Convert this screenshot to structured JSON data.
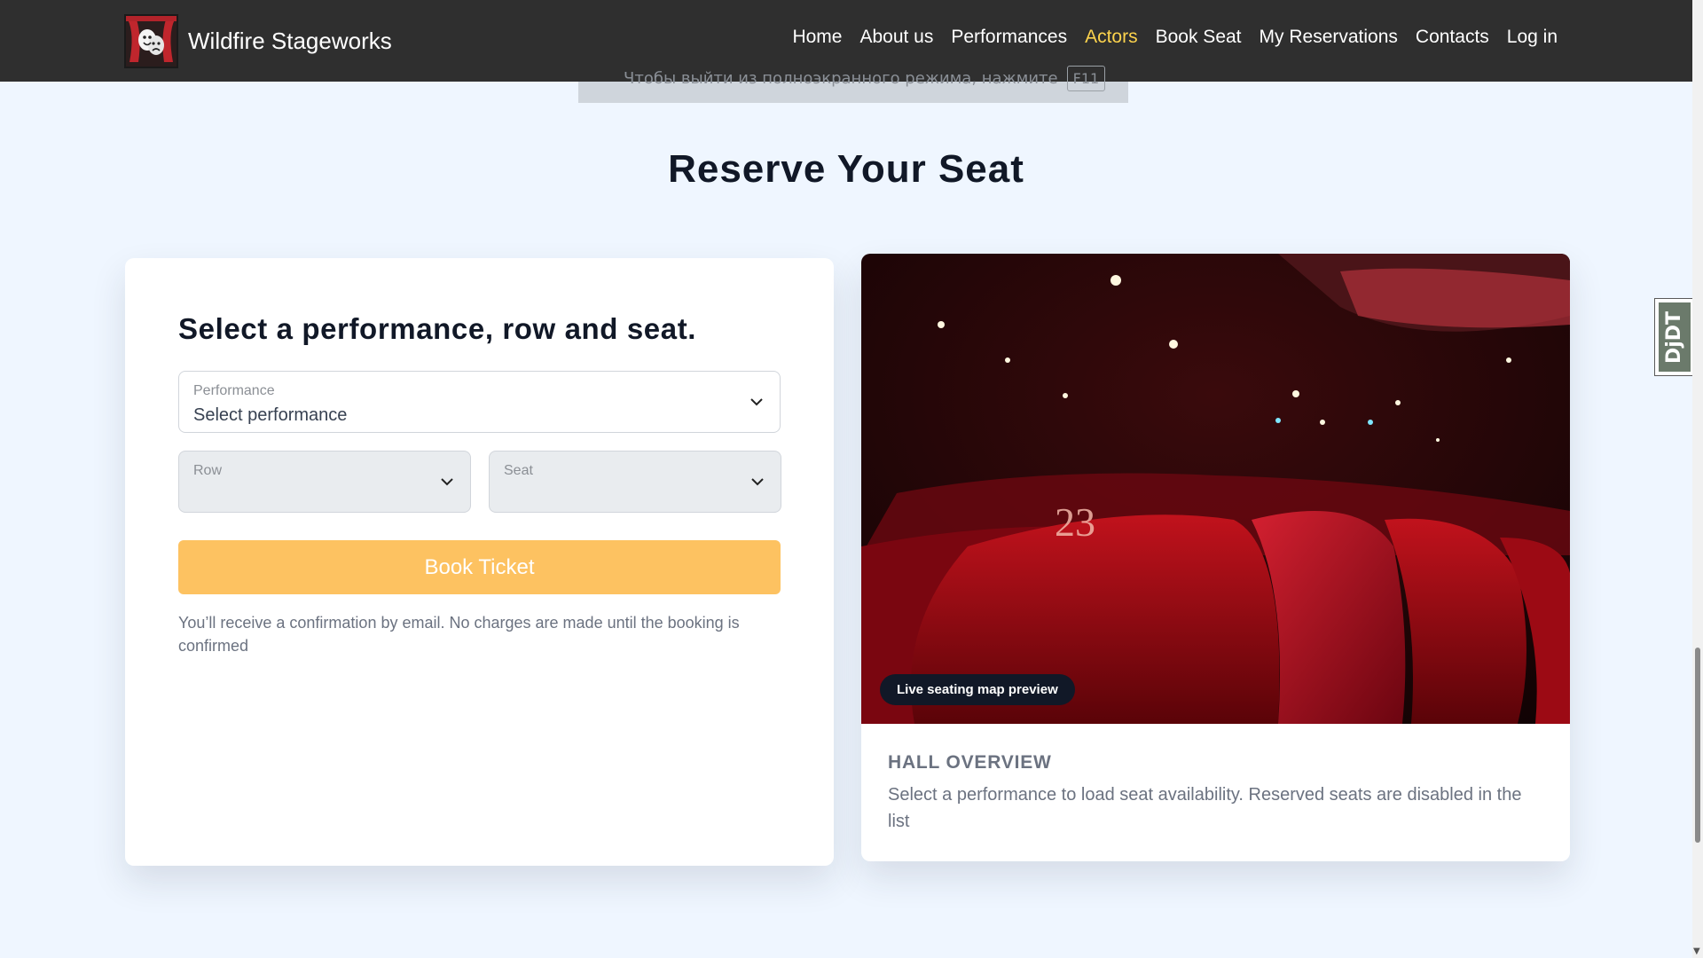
{
  "header": {
    "brand": "Wildfire Stageworks",
    "logo_icon": "theatre-masks-icon",
    "nav": [
      {
        "label": "Home",
        "active": false
      },
      {
        "label": "About us",
        "active": false
      },
      {
        "label": "Performances",
        "active": false
      },
      {
        "label": "Actors",
        "active": true
      },
      {
        "label": "Book Seat",
        "active": false
      },
      {
        "label": "My Reservations",
        "active": false
      },
      {
        "label": "Contacts",
        "active": false
      },
      {
        "label": "Log in",
        "active": false
      }
    ],
    "active_color": "#fcd34d"
  },
  "fullscreen_hint": {
    "text": "Чтобы выйти из полноэкранного режима, нажмите",
    "key": "F11"
  },
  "page_title": "Reserve Your Seat",
  "form": {
    "heading": "Select a performance, row and seat.",
    "performance": {
      "label": "Performance",
      "value": "Select performance"
    },
    "row": {
      "label": "Row",
      "value": ""
    },
    "seat": {
      "label": "Seat",
      "value": ""
    },
    "book_button": "Book Ticket",
    "note": "You’ll receive a confirmation by email. No charges are made until the booking is confirmed"
  },
  "hall": {
    "badge": "Live seating map preview",
    "seat_number": "23",
    "title": "HALL OVERVIEW",
    "description": "Select a performance to load seat availability. Reserved seats are disabled in the list"
  },
  "side_widget": {
    "label": "DjDT"
  },
  "colors": {
    "header_bg": "#2f2f2f",
    "page_bg": "#eff6ff",
    "button_bg": "#fdc261",
    "badge_bg": "#111827"
  }
}
